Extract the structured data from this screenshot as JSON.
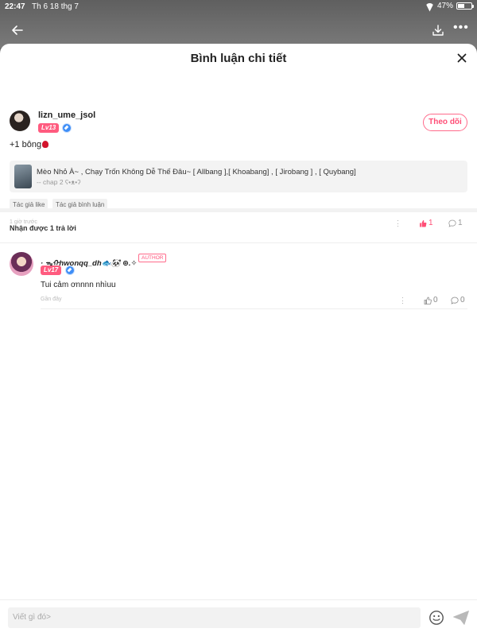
{
  "status_bar": {
    "time": "22:47",
    "date": "Th 6 18 thg 7",
    "battery": "47%",
    "battery_level": 0.47
  },
  "sheet": {
    "title": "Bình luận chi tiết"
  },
  "comment": {
    "user_name": "lizn_ume_jsol",
    "level": "Lv13",
    "follow_label": "Theo dõi",
    "text": "+1 bông",
    "story": {
      "title": "Mèo Nhỏ À~ , Chạy Trốn Không Dễ Thế Đâu~ [ Allbang ],[ Khoabang] , [ Jirobang ] , [ Quybang]",
      "chapter": "-- chap 2 ʕ•ᴥ•ʔ"
    },
    "tags": [
      "Tác giả like",
      "Tác giả bình luận"
    ],
    "timestamp": "1 giờ trước",
    "likes": "1",
    "replies": "1"
  },
  "replies_header": "Nhận được 1 trả lời",
  "reply": {
    "user_name": "· ᯓᡣhwonqq_dh🐟🐼 ⊛.✧",
    "author_badge": "AUTHOR",
    "level": "Lv17",
    "text": "Tui cảm ơnnnn nhìuu",
    "timestamp": "Gần đây",
    "likes": "0",
    "replies": "0"
  },
  "input": {
    "placeholder": "Viết gì đó>"
  },
  "colors": {
    "accent": "#ff4f77",
    "level_badge": "#ff5b7f",
    "diamond": "#3e8ef7"
  }
}
